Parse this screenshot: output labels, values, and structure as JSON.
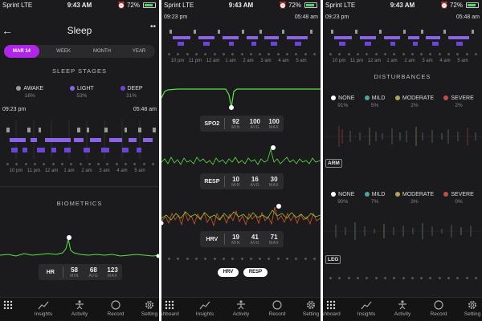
{
  "status": {
    "carrier": "Sprint",
    "network": "LTE",
    "time": "9:43 AM",
    "battery": "72%"
  },
  "p1": {
    "title": "Sleep",
    "segments": [
      "MAR 14",
      "WEEK",
      "MONTH",
      "YEAR"
    ],
    "stages_title": "SLEEP STAGES",
    "stages": [
      {
        "name": "AWAKE",
        "pct": "16%",
        "color": "#9a9a9a"
      },
      {
        "name": "LIGHT",
        "pct": "53%",
        "color": "#8a63e8"
      },
      {
        "name": "DEEP",
        "pct": "31%",
        "color": "#6b45d6"
      }
    ],
    "start_time": "09:23 pm",
    "end_time": "05:48 am",
    "time_labels": [
      "10 pm",
      "11 pm",
      "12 am",
      "1 am",
      "2 am",
      "3 am",
      "4 am",
      "5 am"
    ],
    "biometrics_title": "BIOMETRICS",
    "hr": {
      "label": "HR",
      "min": "58",
      "avg": "68",
      "max": "123"
    }
  },
  "p2": {
    "start_time": "09:23 pm",
    "end_time": "05:48 am",
    "time_labels": [
      "10 pm",
      "11 pm",
      "12 am",
      "1 am",
      "2 am",
      "3 am",
      "4 am",
      "5 am"
    ],
    "spo2": {
      "label": "SPO2",
      "min": "92",
      "avg": "100",
      "max": "100"
    },
    "resp": {
      "label": "RESP",
      "min": "10",
      "avg": "16",
      "max": "30"
    },
    "hrv": {
      "label": "HRV",
      "min": "19",
      "avg": "41",
      "max": "71"
    },
    "pills": [
      "HRV",
      "RESP"
    ]
  },
  "p3": {
    "start_time": "09:23 pm",
    "end_time": "05:48 am",
    "time_labels": [
      "10 pm",
      "11 pm",
      "12 am",
      "1 am",
      "2 am",
      "3 am",
      "4 am",
      "5 am"
    ],
    "disturbances_title": "DISTURBANCES",
    "arm": {
      "label": "ARM",
      "levels": [
        {
          "name": "NONE",
          "pct": "91%",
          "color": "#ffffff"
        },
        {
          "name": "MILD",
          "pct": "5%",
          "color": "#4fa3a3"
        },
        {
          "name": "MODERATE",
          "pct": "2%",
          "color": "#b5a05c"
        },
        {
          "name": "SEVERE",
          "pct": "2%",
          "color": "#c0504d"
        }
      ]
    },
    "leg": {
      "label": "LEG",
      "levels": [
        {
          "name": "NONE",
          "pct": "90%",
          "color": "#ffffff"
        },
        {
          "name": "MILD",
          "pct": "7%",
          "color": "#4fa3a3"
        },
        {
          "name": "MODERATE",
          "pct": "3%",
          "color": "#b5a05c"
        },
        {
          "name": "SEVERE",
          "pct": "0%",
          "color": "#c0504d"
        }
      ]
    }
  },
  "labels": {
    "min": "MIN",
    "avg": "AVG",
    "max": "MAX"
  },
  "tabs": {
    "p1": [
      "",
      "Insights",
      "Activity",
      "Record",
      "Setting"
    ],
    "p2": [
      "shboard",
      "Insights",
      "Activity",
      "Record",
      "Setting"
    ],
    "p3": [
      "shboard",
      "Insights",
      "Activity",
      "Record",
      "Setting"
    ]
  },
  "colors": {
    "accent": "#b026e8",
    "light": "#8a63e8",
    "deep": "#6b45d6",
    "awake": "#9a9a9a",
    "signal": "#5ee04a",
    "background": "#1b1b1d"
  }
}
